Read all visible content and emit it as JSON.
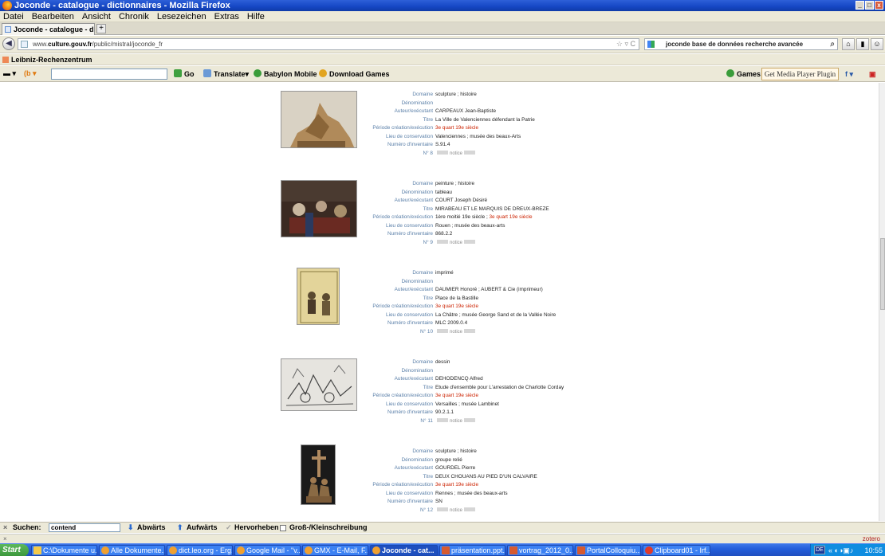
{
  "window": {
    "title": "Joconde - catalogue - dictionnaires - Mozilla Firefox"
  },
  "menu": [
    "Datei",
    "Bearbeiten",
    "Ansicht",
    "Chronik",
    "Lesezeichen",
    "Extras",
    "Hilfe"
  ],
  "tab": {
    "label": "Joconde - catalogue - dictionnaires",
    "new_tab": "+"
  },
  "nav": {
    "url_prefix": "www.",
    "url_domain": "culture.gouv.fr",
    "url_path": "/public/mistral/joconde_fr",
    "search_value": "joconde base de données recherche avancée"
  },
  "bookmarks": {
    "item": "Leibniz-Rechenzentrum"
  },
  "toolbar": {
    "go": "Go",
    "translate": "Translate",
    "babylon": "Babylon Mobile",
    "download": "Download Games",
    "games": "Games",
    "media_player": "Get Media Player Plugin"
  },
  "labels": {
    "domaine": "Domaine",
    "denomination": "Dénomination",
    "auteur": "Auteur/exécutant",
    "titre": "Titre",
    "periode": "Période création/exécution",
    "lieu": "Lieu de conservation",
    "inventaire": "Numéro d'inventaire",
    "notice": "notice"
  },
  "records": [
    {
      "domaine": "sculpture ; histoire",
      "denomination": "",
      "auteur": "CARPEAUX Jean-Baptiste",
      "titre": "La Ville de Valenciennes défendant la Patrie",
      "periode_a": "",
      "periode_b": "3e quart 19e siècle",
      "lieu": "Valenciennes ; musée des beaux-Arts",
      "inventaire": "S.91.4",
      "num": "N° 8"
    },
    {
      "domaine": "peinture ; histoire",
      "denomination": "tableau",
      "auteur": "COURT Joseph Désiré",
      "titre": "MIRABEAU ET LE MARQUIS DE DREUX-BREZE",
      "periode_a": "1ère moitié 19e siècle ; ",
      "periode_b": "3e quart 19e siècle",
      "lieu": "Rouen ; musée des beaux-arts",
      "inventaire": "868.2.2",
      "num": "N° 9"
    },
    {
      "domaine": "imprimé",
      "denomination": "",
      "auteur": "DAUMIER Honoré ; AUBERT & Cie (imprimeur)",
      "titre": "Place de la Bastille",
      "periode_a": "",
      "periode_b": "3e quart 19e siècle",
      "lieu": "La Châtre ; musée George Sand et de la Vallée Noire",
      "inventaire": "MLC 2009.0.4",
      "num": "N° 10"
    },
    {
      "domaine": "dessin",
      "denomination": "",
      "auteur": "DEHODENCQ Alfred",
      "titre": "Etude d'ensemble pour L'arrestation de Charlotte Corday",
      "periode_a": "",
      "periode_b": "3e quart 19e siècle",
      "lieu": "Versailles ; musée Lambinet",
      "inventaire": "90.2.1.1",
      "num": "N° 11"
    },
    {
      "domaine": "sculpture ; histoire",
      "denomination": "groupe relié",
      "auteur": "GOURDEL Pierre",
      "titre": "DEUX CHOUANS AU PIED D'UN CALVAIRE",
      "periode_a": "",
      "periode_b": "3e quart 19e siècle",
      "lieu": "Rennes ; musée des beaux-arts",
      "inventaire": "SN",
      "num": "N° 12"
    }
  ],
  "findbar": {
    "close": "×",
    "label": "Suchen:",
    "value": "contend",
    "down": "Abwärts",
    "up": "Aufwärts",
    "highlight": "Hervorheben",
    "case": "Groß-/Kleinschreibung"
  },
  "status": {
    "close": "×",
    "zotero": "zotero"
  },
  "taskbar": {
    "start": "Start",
    "items": [
      "C:\\Dokumente u...",
      "Alle Dokumente...",
      "dict.leo.org - Erg...",
      "Google Mail - \"v...",
      "GMX - E-Mail, F...",
      "Joconde - cat...",
      "präsentation.ppt...",
      "vortrag_2012_0...",
      "PortalColloquiu...",
      "Clipboard01 - Irf..."
    ],
    "lang": "DE",
    "time": "10:55"
  },
  "colors": {
    "label": "#5a7fa8",
    "accent_red": "#cc2200",
    "titlebar": "#1546c4"
  }
}
